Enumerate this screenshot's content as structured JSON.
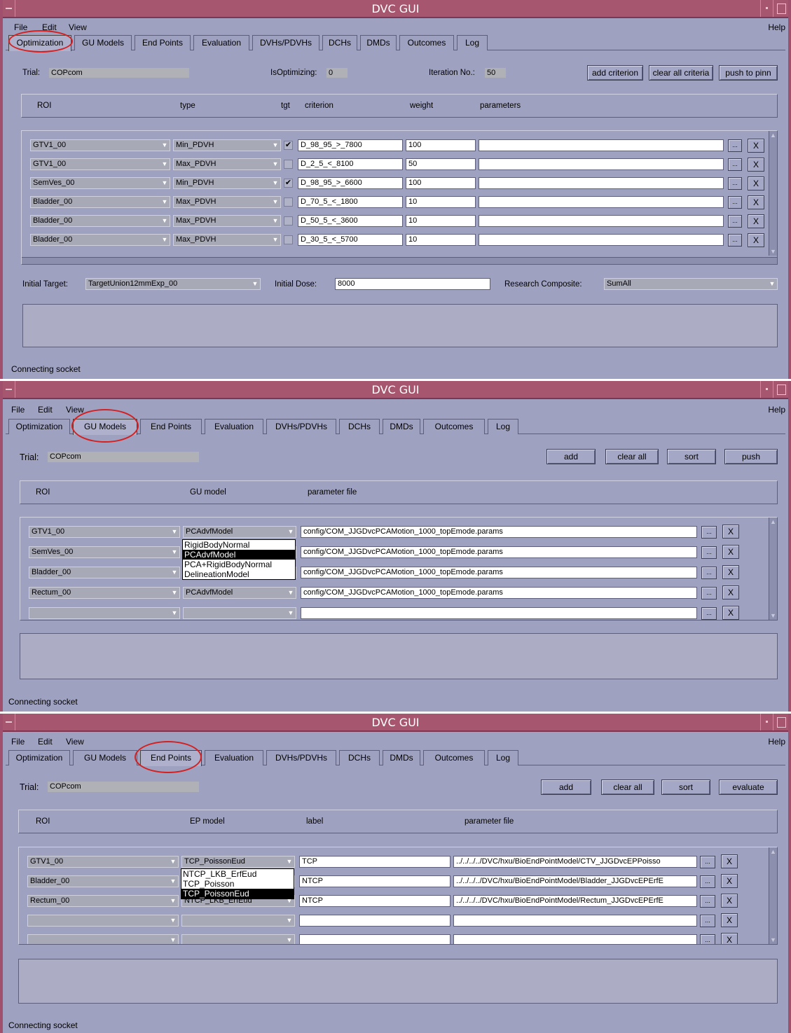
{
  "app": {
    "title": "DVC GUI",
    "status": "Connecting socket"
  },
  "menu": {
    "file": "File",
    "edit": "Edit",
    "view": "View",
    "help": "Help"
  },
  "tabs": [
    "Optimization",
    "GU Models",
    "End Points",
    "Evaluation",
    "DVHs/PDVHs",
    "DCHs",
    "DMDs",
    "Outcomes",
    "Log"
  ],
  "colors": {
    "title_bar": "#a6566f",
    "window_bg": "#9fa1c0",
    "highlight_ring": "#d42020"
  },
  "optimization": {
    "trial_label": "Trial:",
    "trial": "COPcom",
    "isopt_label": "IsOptimizing:",
    "isopt": "0",
    "iter_label": "Iteration No.:",
    "iter": "50",
    "buttons": {
      "add": "add criterion",
      "clear": "clear all criteria",
      "push": "push to pinn"
    },
    "headers": {
      "roi": "ROI",
      "type": "type",
      "tgt": "tgt",
      "criterion": "criterion",
      "weight": "weight",
      "parameters": "parameters"
    },
    "rows": [
      {
        "roi": "GTV1_00",
        "type": "Min_PDVH",
        "tgt": true,
        "criterion": "D_98_95_>_7800",
        "weight": "100",
        "params": ""
      },
      {
        "roi": "GTV1_00",
        "type": "Max_PDVH",
        "tgt": false,
        "criterion": "D_2_5_<_8100",
        "weight": "50",
        "params": ""
      },
      {
        "roi": "SemVes_00",
        "type": "Min_PDVH",
        "tgt": true,
        "criterion": "D_98_95_>_6600",
        "weight": "100",
        "params": ""
      },
      {
        "roi": "Bladder_00",
        "type": "Max_PDVH",
        "tgt": false,
        "criterion": "D_70_5_<_1800",
        "weight": "10",
        "params": ""
      },
      {
        "roi": "Bladder_00",
        "type": "Max_PDVH",
        "tgt": false,
        "criterion": "D_50_5_<_3600",
        "weight": "10",
        "params": ""
      },
      {
        "roi": "Bladder_00",
        "type": "Max_PDVH",
        "tgt": false,
        "criterion": "D_30_5_<_5700",
        "weight": "10",
        "params": ""
      }
    ],
    "ellipsis": "...",
    "x": "X",
    "initial_target_label": "Initial Target:",
    "initial_target": "TargetUnion12mmExp_00",
    "initial_dose_label": "Initial Dose:",
    "initial_dose": "8000",
    "research_label": "Research Composite:",
    "research": "SumAll"
  },
  "gu": {
    "trial_label": "Trial:",
    "trial": "COPcom",
    "buttons": {
      "add": "add",
      "clear": "clear all",
      "sort": "sort",
      "push": "push"
    },
    "headers": {
      "roi": "ROI",
      "model": "GU model",
      "file": "parameter file"
    },
    "rows": [
      {
        "roi": "GTV1_00",
        "model": "PCAdvfModel",
        "file": "config/COM_JJGDvcPCAMotion_1000_topEmode.params"
      },
      {
        "roi": "SemVes_00",
        "model": "PCAdvfModel",
        "file": "config/COM_JJGDvcPCAMotion_1000_topEmode.params"
      },
      {
        "roi": "Bladder_00",
        "model": "PCAdvfModel",
        "file": "config/COM_JJGDvcPCAMotion_1000_topEmode.params"
      },
      {
        "roi": "Rectum_00",
        "model": "PCAdvfModel",
        "file": "config/COM_JJGDvcPCAMotion_1000_topEmode.params"
      },
      {
        "roi": "",
        "model": "",
        "file": ""
      }
    ],
    "dropdown": [
      "RigidBodyNormal",
      "PCAdvfModel",
      "PCA+RigidBodyNormal",
      "DelineationModel"
    ],
    "dropdown_selected": "PCAdvfModel"
  },
  "ep": {
    "trial_label": "Trial:",
    "trial": "COPcom",
    "buttons": {
      "add": "add",
      "clear": "clear all",
      "sort": "sort",
      "evaluate": "evaluate"
    },
    "headers": {
      "roi": "ROI",
      "model": "EP model",
      "label": "label",
      "file": "parameter file"
    },
    "rows": [
      {
        "roi": "GTV1_00",
        "model": "TCP_PoissonEud",
        "label": "TCP",
        "file": "../../../../DVC/hxu/BioEndPointModel/CTV_JJGDvcEPPoisso"
      },
      {
        "roi": "Bladder_00",
        "model": "NTCP_LKB_ErfEud",
        "label": "NTCP",
        "file": "../../../../DVC/hxu/BioEndPointModel/Bladder_JJGDvcEPErfE"
      },
      {
        "roi": "Rectum_00",
        "model": "NTCP_LKB_ErfEud",
        "label": "NTCP",
        "file": "../../../../DVC/hxu/BioEndPointModel/Rectum_JJGDvcEPErfE"
      },
      {
        "roi": "",
        "model": "",
        "label": "",
        "file": ""
      },
      {
        "roi": "",
        "model": "",
        "label": "",
        "file": ""
      }
    ],
    "dropdown": [
      "NTCP_LKB_ErfEud",
      "TCP_Poisson",
      "TCP_PoissonEud"
    ],
    "dropdown_selected": "TCP_PoissonEud"
  }
}
